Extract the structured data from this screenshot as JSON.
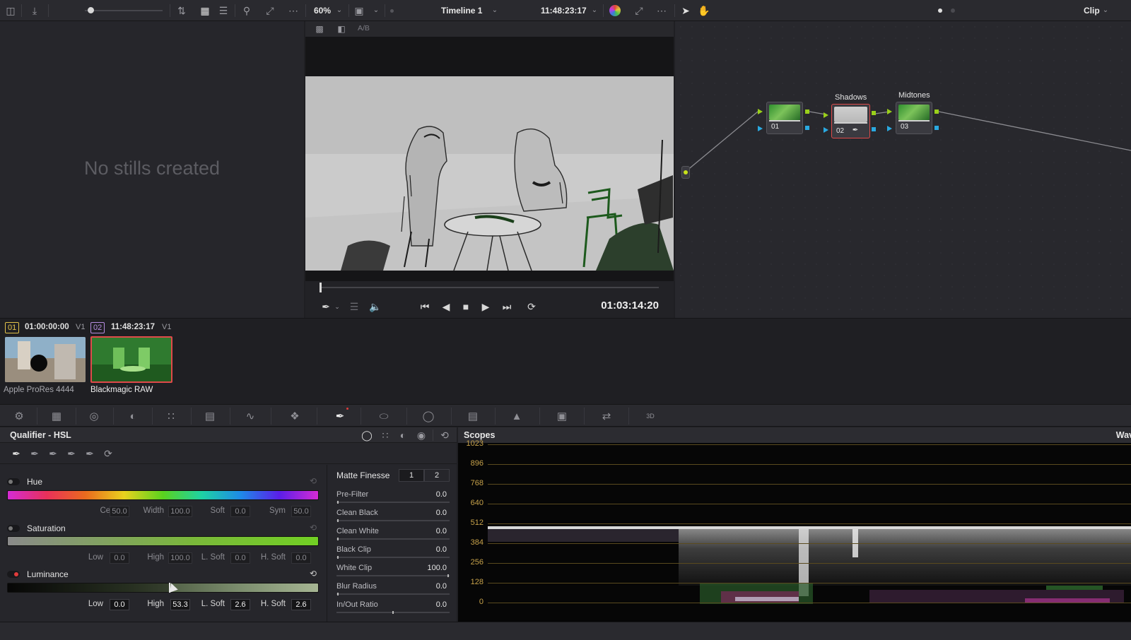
{
  "toolbar": {
    "zoom": "60%",
    "timeline_name": "Timeline 1",
    "timecode": "11:48:23:17",
    "mode": "Clip"
  },
  "gallery": {
    "empty_text": "No stills created"
  },
  "viewer": {
    "ab_label": "A/B",
    "timecode": "01:03:14:20",
    "scrub_position": 0.0
  },
  "nodes": {
    "items": [
      {
        "number": "01",
        "label": ""
      },
      {
        "number": "02",
        "label": "Shadows"
      },
      {
        "number": "03",
        "label": "Midtones"
      }
    ]
  },
  "clips": [
    {
      "number": "01",
      "timecode": "01:00:00:00",
      "track": "V1",
      "codec": "Apple ProRes 4444",
      "selected": false
    },
    {
      "number": "02",
      "timecode": "11:48:23:17",
      "track": "V1",
      "codec": "Blackmagic RAW",
      "selected": true
    }
  ],
  "qualifier": {
    "title": "Qualifier - HSL",
    "hue": {
      "label": "Hue",
      "enabled": false,
      "params": [
        {
          "label": "Center",
          "value": "50.0"
        },
        {
          "label": "Width",
          "value": "100.0"
        },
        {
          "label": "Soft",
          "value": "0.0"
        },
        {
          "label": "Sym",
          "value": "50.0"
        }
      ]
    },
    "saturation": {
      "label": "Saturation",
      "enabled": false,
      "params": [
        {
          "label": "Low",
          "value": "0.0"
        },
        {
          "label": "High",
          "value": "100.0"
        },
        {
          "label": "L. Soft",
          "value": "0.0"
        },
        {
          "label": "H. Soft",
          "value": "0.0"
        }
      ]
    },
    "luminance": {
      "label": "Luminance",
      "enabled": true,
      "params": [
        {
          "label": "Low",
          "value": "0.0"
        },
        {
          "label": "High",
          "value": "53.3"
        },
        {
          "label": "L. Soft",
          "value": "2.6"
        },
        {
          "label": "H. Soft",
          "value": "2.6"
        }
      ]
    }
  },
  "matte_finesse": {
    "title": "Matte Finesse",
    "tabs": [
      "1",
      "2"
    ],
    "rows": [
      {
        "label": "Pre-Filter",
        "value": "0.0"
      },
      {
        "label": "Clean Black",
        "value": "0.0"
      },
      {
        "label": "Clean White",
        "value": "0.0"
      },
      {
        "label": "Black Clip",
        "value": "0.0"
      },
      {
        "label": "White Clip",
        "value": "100.0"
      },
      {
        "label": "Blur Radius",
        "value": "0.0"
      },
      {
        "label": "In/Out Ratio",
        "value": "0.0"
      }
    ]
  },
  "scopes": {
    "title": "Scopes",
    "mode": "Wav",
    "scale": [
      "1023",
      "896",
      "768",
      "640",
      "512",
      "384",
      "256",
      "128",
      "0"
    ]
  },
  "colors": {
    "accent_red": "#e03b3b",
    "scope_label": "#c7a24a",
    "node_output": "#9ad01a",
    "node_key": "#2aa9e0"
  }
}
